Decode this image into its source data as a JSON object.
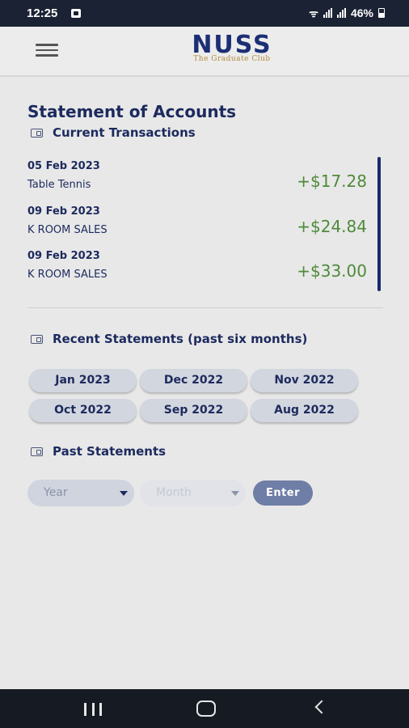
{
  "status_bar": {
    "time": "12:25",
    "battery": "46%"
  },
  "header": {
    "logo_text": "NUSS",
    "logo_subtitle": "The Graduate Club"
  },
  "page": {
    "title": "Statement of Accounts"
  },
  "current_transactions": {
    "heading": "Current Transactions",
    "items": [
      {
        "date": "05 Feb 2023",
        "description": "Table Tennis",
        "amount": "+$17.28"
      },
      {
        "date": "09 Feb 2023",
        "description": "K ROOM SALES",
        "amount": "+$24.84"
      },
      {
        "date": "09 Feb 2023",
        "description": "K ROOM SALES",
        "amount": "+$33.00"
      }
    ]
  },
  "recent_statements": {
    "heading": "Recent Statements (past six months)",
    "months": [
      "Jan 2023",
      "Dec 2022",
      "Nov 2022",
      "Oct 2022",
      "Sep 2022",
      "Aug 2022"
    ]
  },
  "past_statements": {
    "heading": "Past Statements",
    "year_placeholder": "Year",
    "month_placeholder": "Month",
    "enter_label": "Enter"
  },
  "colors": {
    "primary": "#1c2a5e",
    "amount_green": "#4f8a3b",
    "enter_button": "#6f7ea6"
  }
}
